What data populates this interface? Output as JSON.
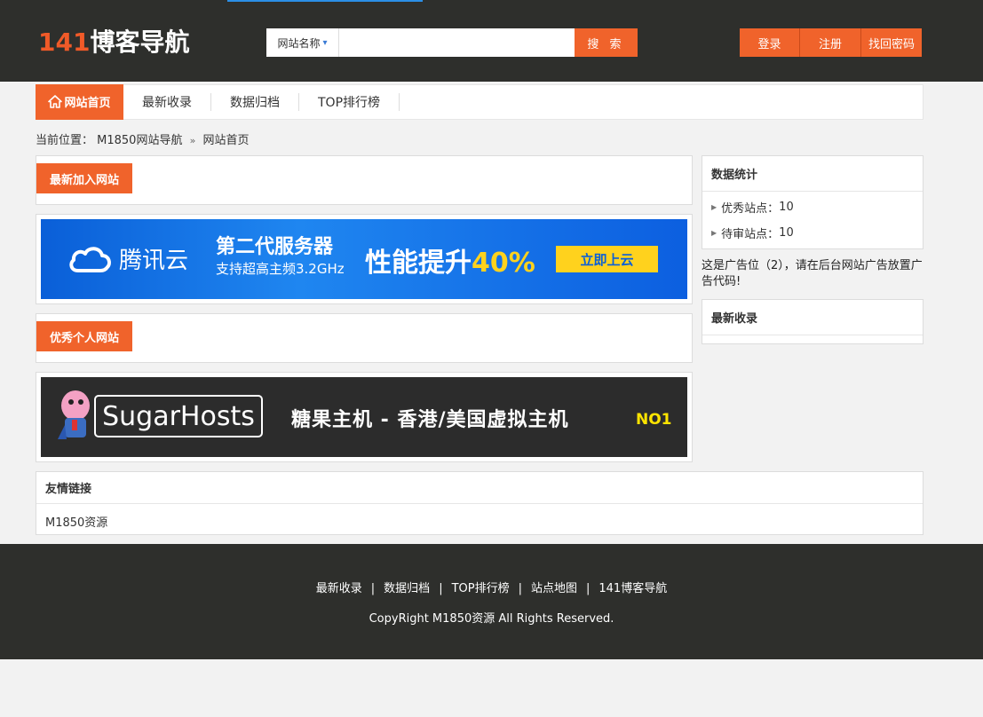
{
  "header": {
    "logo_number": "141",
    "logo_text": "博客导航",
    "search": {
      "select_label": "网站名称",
      "placeholder": "",
      "button": "搜 索"
    },
    "auth": {
      "login": "登录",
      "register": "注册",
      "forgot": "找回密码"
    }
  },
  "nav": {
    "home": "网站首页",
    "items": [
      "最新收录",
      "数据归档",
      "TOP排行榜"
    ]
  },
  "breadcrumb": {
    "prefix": "当前位置：",
    "site": "M1850网站导航",
    "current": "网站首页"
  },
  "main": {
    "section1_title": "最新加入网站",
    "section2_title": "优秀个人网站",
    "banner1": {
      "logo": "腾讯云",
      "line1": "第二代服务器",
      "line2": "支持超高主频3.2GHz",
      "perf": "性能提升",
      "perf_value": "40%",
      "cta": "立即上云"
    },
    "banner2": {
      "brand": "SugarHosts",
      "slogan": "糖果主机 - 香港/美国虚拟主机",
      "badge": "NO1"
    }
  },
  "sidebar": {
    "stats_title": "数据统计",
    "stats": [
      {
        "label": "优秀站点：",
        "value": "10"
      },
      {
        "label": "待审站点：",
        "value": "10"
      }
    ],
    "ad_text": "这是广告位（2），请在后台网站广告放置广告代码!",
    "recent_title": "最新收录"
  },
  "friends": {
    "title": "友情链接",
    "links": [
      "M1850资源"
    ]
  },
  "footer": {
    "links": [
      "最新收录",
      "数据归档",
      "TOP排行榜",
      "站点地图",
      "141博客导航"
    ],
    "copyright": "CopyRight M1850资源 All Rights Reserved."
  },
  "colors": {
    "accent": "#f0632b",
    "header_bg": "#2e2f2c",
    "page_bg": "#f2f2f2"
  }
}
